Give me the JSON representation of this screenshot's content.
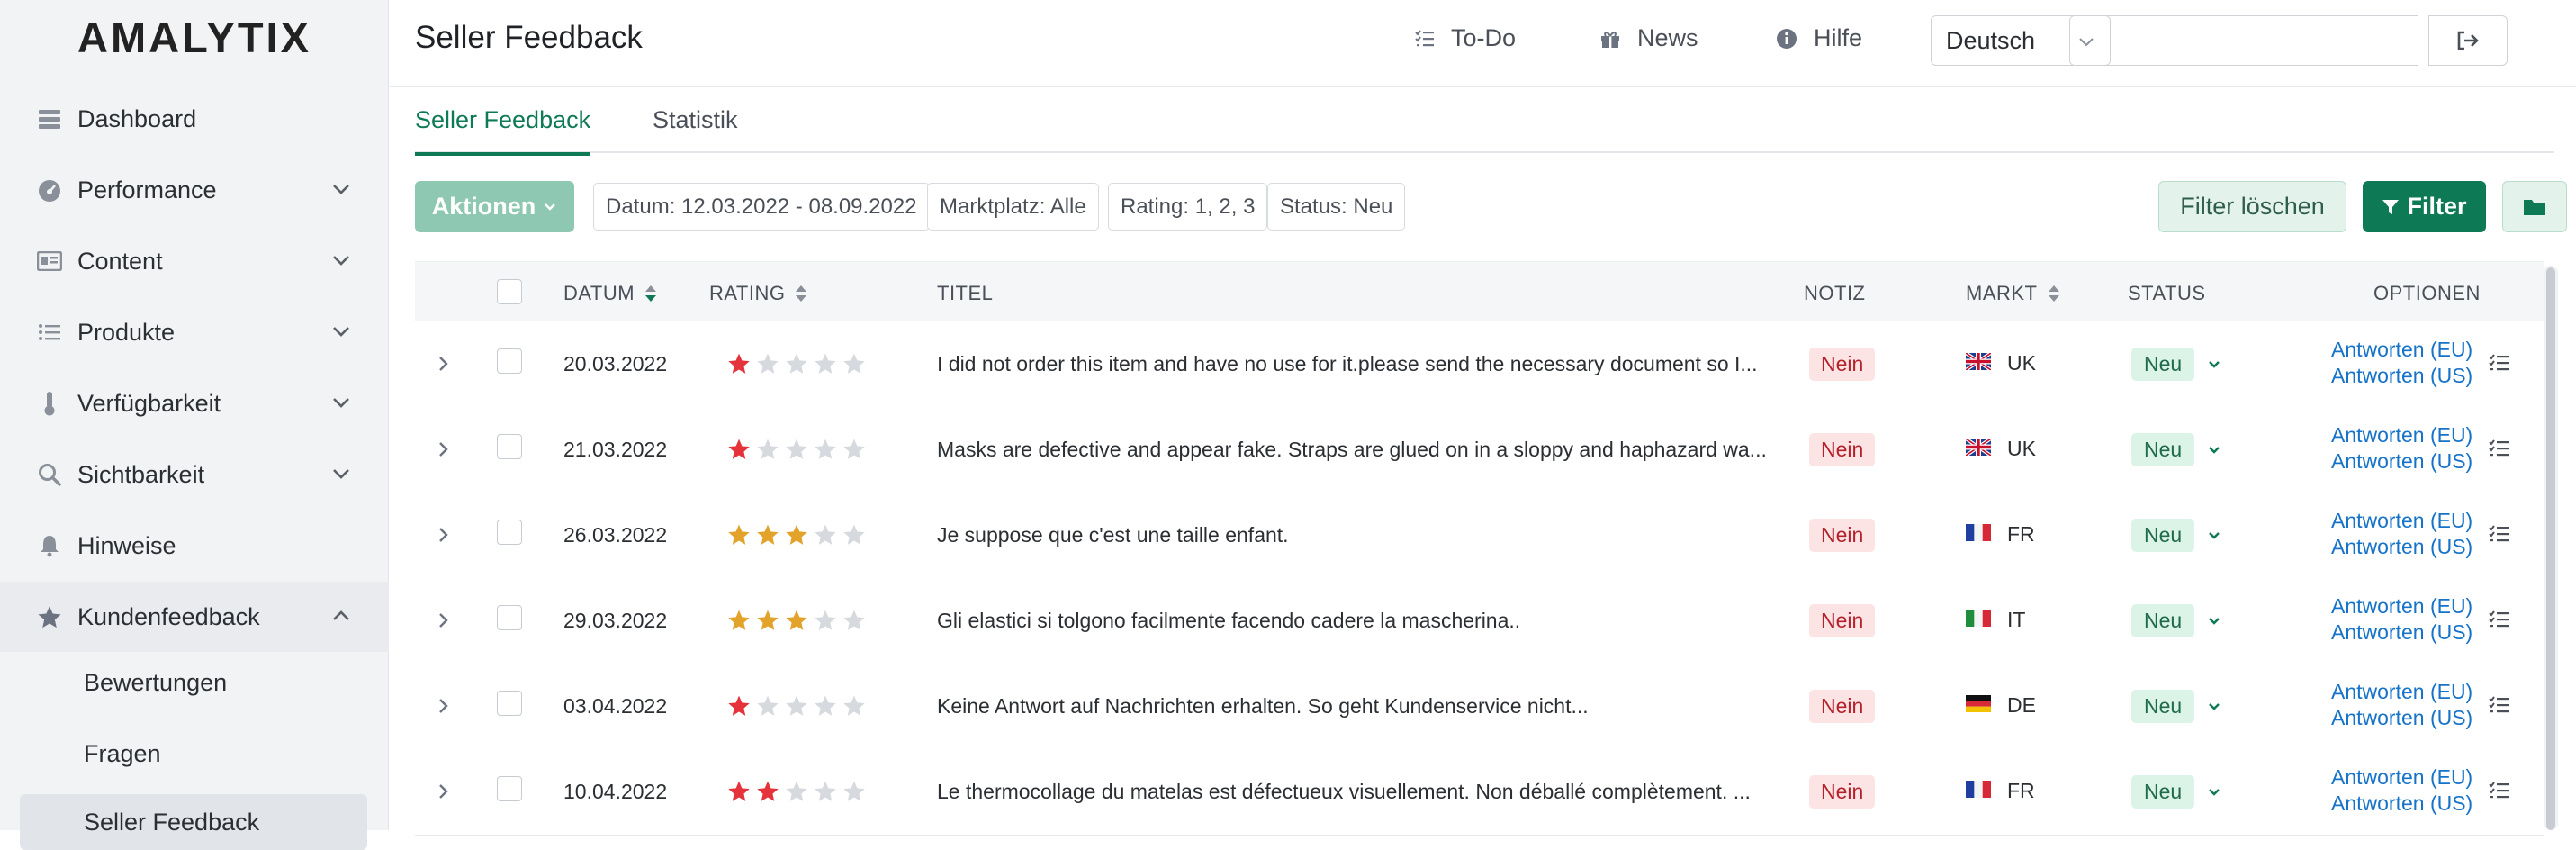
{
  "logo": "AMALYTIX",
  "sidebar": {
    "items": [
      {
        "label": "Dashboard",
        "icon": "dashboard-icon"
      },
      {
        "label": "Performance",
        "icon": "gauge-icon"
      },
      {
        "label": "Content",
        "icon": "content-icon"
      },
      {
        "label": "Produkte",
        "icon": "list-icon"
      },
      {
        "label": "Verfügbarkeit",
        "icon": "thermometer-icon"
      },
      {
        "label": "Sichtbarkeit",
        "icon": "search-icon"
      },
      {
        "label": "Hinweise",
        "icon": "bell-icon"
      },
      {
        "label": "Kundenfeedback",
        "icon": "star-icon"
      }
    ],
    "subitems": [
      {
        "label": "Bewertungen"
      },
      {
        "label": "Fragen"
      },
      {
        "label": "Seller Feedback",
        "active": true
      }
    ]
  },
  "header": {
    "title": "Seller Feedback",
    "todo": "To-Do",
    "news": "News",
    "help": "Hilfe",
    "language": "Deutsch"
  },
  "tabs": [
    {
      "label": "Seller Feedback",
      "active": true
    },
    {
      "label": "Statistik"
    }
  ],
  "filters": {
    "actions": "Aktionen",
    "chips": [
      "Datum: 12.03.2022 - 08.09.2022",
      "Marktplatz: Alle",
      "Rating: 1, 2, 3",
      "Status: Neu"
    ],
    "clear": "Filter löschen",
    "filter": "Filter"
  },
  "table": {
    "headers": {
      "date": "DATUM",
      "rating": "RATING",
      "title": "TITEL",
      "note": "NOTIZ",
      "market": "MARKT",
      "status": "STATUS",
      "options": "OPTIONEN"
    },
    "rows": [
      {
        "date": "20.03.2022",
        "rating": 1,
        "title": "I did not order this item and have no use for it.please send the necessary document so I...",
        "note": "Nein",
        "market": "UK",
        "flag": "uk",
        "status": "Neu",
        "reply_eu": "Antworten (EU)",
        "reply_us": "Antworten (US)"
      },
      {
        "date": "21.03.2022",
        "rating": 1,
        "title": "Masks are defective and appear fake. Straps are glued on in a sloppy and haphazard wa...",
        "note": "Nein",
        "market": "UK",
        "flag": "uk",
        "status": "Neu",
        "reply_eu": "Antworten (EU)",
        "reply_us": "Antworten (US)"
      },
      {
        "date": "26.03.2022",
        "rating": 3,
        "title": "Je suppose que c'est une taille enfant.",
        "note": "Nein",
        "market": "FR",
        "flag": "fr",
        "status": "Neu",
        "reply_eu": "Antworten (EU)",
        "reply_us": "Antworten (US)"
      },
      {
        "date": "29.03.2022",
        "rating": 3,
        "title": "Gli elastici si tolgono facilmente facendo cadere la mascherina..",
        "note": "Nein",
        "market": "IT",
        "flag": "it",
        "status": "Neu",
        "reply_eu": "Antworten (EU)",
        "reply_us": "Antworten (US)"
      },
      {
        "date": "03.04.2022",
        "rating": 1,
        "title": "Keine Antwort auf Nachrichten erhalten. So geht Kundenservice nicht...",
        "note": "Nein",
        "market": "DE",
        "flag": "de",
        "status": "Neu",
        "reply_eu": "Antworten (EU)",
        "reply_us": "Antworten (US)"
      },
      {
        "date": "10.04.2022",
        "rating": 2,
        "title": "Le thermocollage du matelas est défectueux visuellement. Non déballé complètement. ...",
        "note": "Nein",
        "market": "FR",
        "flag": "fr",
        "status": "Neu",
        "reply_eu": "Antworten (EU)",
        "reply_us": "Antworten (US)"
      }
    ]
  },
  "colors": {
    "accent": "#0e7a55",
    "star_red": "#e5333b",
    "star_gold": "#e3a22a",
    "star_empty": "#d6d9dd",
    "link": "#1673c8"
  }
}
